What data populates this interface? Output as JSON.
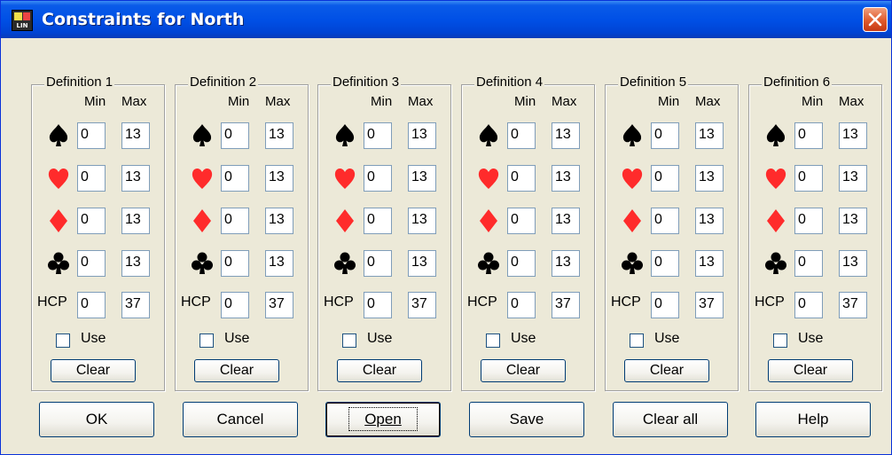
{
  "window": {
    "title": "Constraints for North",
    "icon": "lin-app-icon"
  },
  "headers": {
    "min": "Min",
    "max": "Max",
    "hcp": "HCP",
    "use": "Use",
    "clear": "Clear"
  },
  "definitions": [
    {
      "label": "Definition 1",
      "spades": {
        "min": "0",
        "max": "13"
      },
      "hearts": {
        "min": "0",
        "max": "13"
      },
      "diamonds": {
        "min": "0",
        "max": "13"
      },
      "clubs": {
        "min": "0",
        "max": "13"
      },
      "hcp": {
        "min": "0",
        "max": "37"
      },
      "use": false
    },
    {
      "label": "Definition 2",
      "spades": {
        "min": "0",
        "max": "13"
      },
      "hearts": {
        "min": "0",
        "max": "13"
      },
      "diamonds": {
        "min": "0",
        "max": "13"
      },
      "clubs": {
        "min": "0",
        "max": "13"
      },
      "hcp": {
        "min": "0",
        "max": "37"
      },
      "use": false
    },
    {
      "label": "Definition 3",
      "spades": {
        "min": "0",
        "max": "13"
      },
      "hearts": {
        "min": "0",
        "max": "13"
      },
      "diamonds": {
        "min": "0",
        "max": "13"
      },
      "clubs": {
        "min": "0",
        "max": "13"
      },
      "hcp": {
        "min": "0",
        "max": "37"
      },
      "use": false
    },
    {
      "label": "Definition 4",
      "spades": {
        "min": "0",
        "max": "13"
      },
      "hearts": {
        "min": "0",
        "max": "13"
      },
      "diamonds": {
        "min": "0",
        "max": "13"
      },
      "clubs": {
        "min": "0",
        "max": "13"
      },
      "hcp": {
        "min": "0",
        "max": "37"
      },
      "use": false
    },
    {
      "label": "Definition 5",
      "spades": {
        "min": "0",
        "max": "13"
      },
      "hearts": {
        "min": "0",
        "max": "13"
      },
      "diamonds": {
        "min": "0",
        "max": "13"
      },
      "clubs": {
        "min": "0",
        "max": "13"
      },
      "hcp": {
        "min": "0",
        "max": "37"
      },
      "use": false
    },
    {
      "label": "Definition 6",
      "spades": {
        "min": "0",
        "max": "13"
      },
      "hearts": {
        "min": "0",
        "max": "13"
      },
      "diamonds": {
        "min": "0",
        "max": "13"
      },
      "clubs": {
        "min": "0",
        "max": "13"
      },
      "hcp": {
        "min": "0",
        "max": "37"
      },
      "use": false
    }
  ],
  "buttons": {
    "ok": "OK",
    "cancel": "Cancel",
    "open": "Open",
    "save": "Save",
    "clear_all": "Clear all",
    "help": "Help"
  },
  "colors": {
    "red_suit": "#FF2B2B",
    "black_suit": "#000000",
    "titlebar": "#0054E3",
    "dialog_bg": "#ECE9D8"
  }
}
